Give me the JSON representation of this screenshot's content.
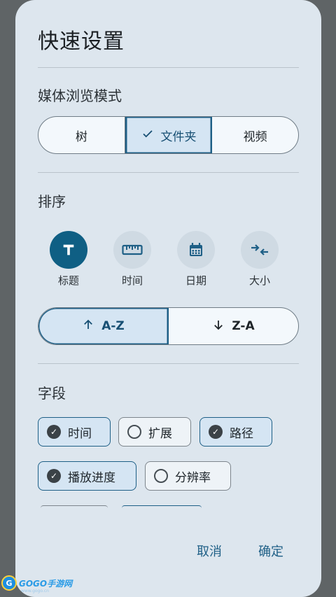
{
  "dialog": {
    "title": "快速设置",
    "browse_mode": {
      "label": "媒体浏览模式",
      "options": [
        "树",
        "文件夹",
        "视频"
      ],
      "selected": "文件夹"
    },
    "sort": {
      "label": "排序",
      "options": [
        {
          "label": "标题",
          "icon": "title-icon",
          "active": true
        },
        {
          "label": "时间",
          "icon": "ruler-icon",
          "active": false
        },
        {
          "label": "日期",
          "icon": "calendar-icon",
          "active": false
        },
        {
          "label": "大小",
          "icon": "compare-arrows-icon",
          "active": false
        }
      ],
      "order": {
        "asc": "A-Z",
        "desc": "Z-A",
        "selected": "A-Z"
      }
    },
    "fields": {
      "label": "字段",
      "chips": [
        {
          "label": "时间",
          "checked": true
        },
        {
          "label": "扩展",
          "checked": false
        },
        {
          "label": "路径",
          "checked": true
        },
        {
          "label": "播放进度",
          "checked": true
        },
        {
          "label": "分辨率",
          "checked": false
        }
      ]
    },
    "actions": {
      "cancel": "取消",
      "confirm": "确定"
    }
  },
  "watermark": {
    "brand": "GOGO手游网",
    "url": "www.gogo.cn"
  },
  "colors": {
    "accent": "#1e5f86",
    "sheet": "#dde6ee",
    "scrim": "#5f6466"
  }
}
